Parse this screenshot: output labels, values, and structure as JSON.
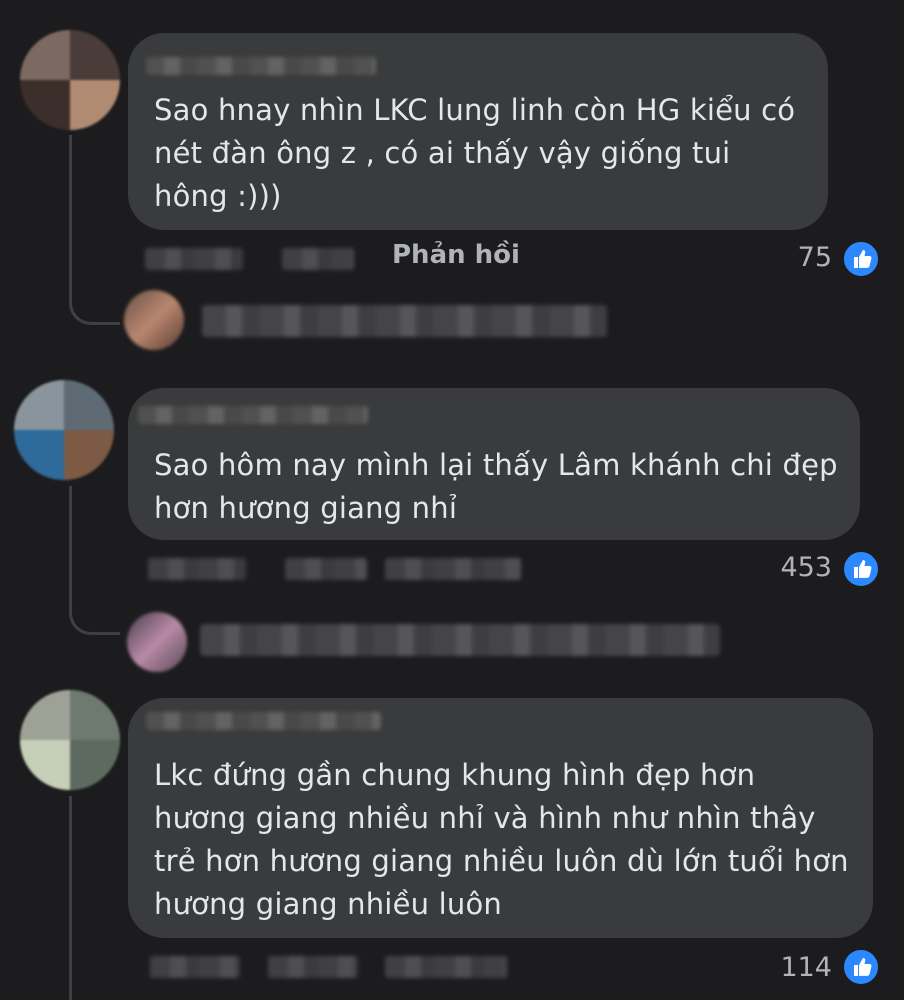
{
  "comments": [
    {
      "text": "Sao hnay nhìn LKC lung linh còn HG kiểu có\nnét đàn ông z , có ai thấy vậy giống tui\nhông :)))",
      "reply_label": "Phản hồi",
      "likes": "75"
    },
    {
      "text": "Sao hôm nay mình lại thấy Lâm khánh chi đẹp\nhơn hương giang nhỉ",
      "likes": "453"
    },
    {
      "text": "Lkc đứng gần chung khung hình đẹp hơn\nhương giang nhiều nhỉ và hình như nhìn thây\ntrẻ hơn hương giang nhiều luôn dù lớn tuổi hơn\nhương giang nhiều luôn",
      "likes": "114"
    }
  ],
  "colors": {
    "background": "#1c1c1e",
    "bubble": "#3a3b3c",
    "text": "#e4e6eb",
    "muted": "#b0b3b8",
    "like_blue": "#2d88ff"
  },
  "icons": {
    "like": "thumbs-up-icon"
  }
}
